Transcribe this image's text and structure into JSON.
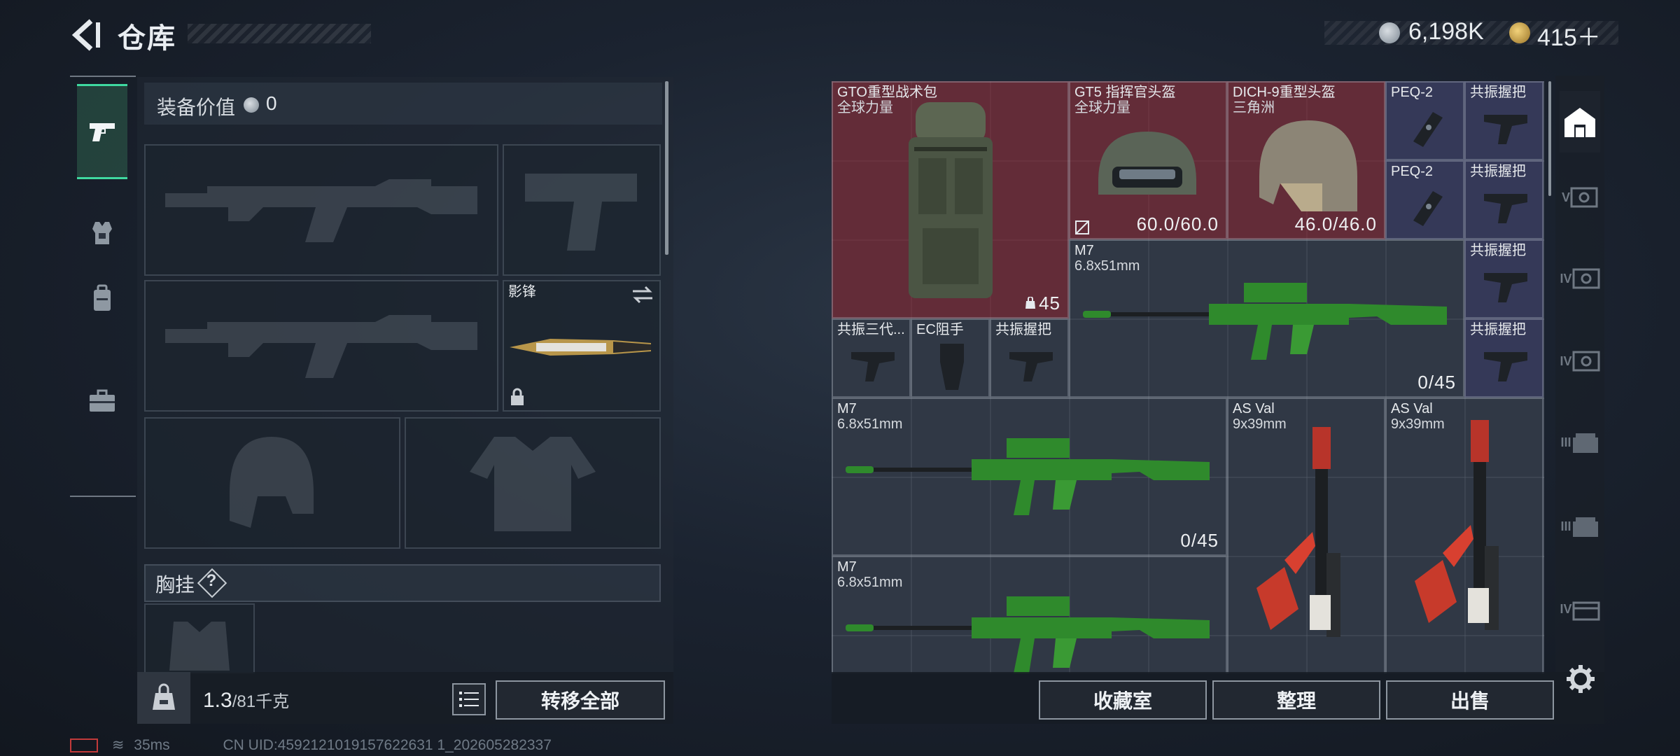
{
  "header": {
    "title": "仓库",
    "money": "6,198K",
    "coupons": "415＋",
    "version_text": "…"
  },
  "equipment": {
    "value_label": "装备价值",
    "value": "0",
    "melee_name": "影锋",
    "chest_rig_label": "胸挂",
    "help_glyph": "?",
    "weight_current": "1.3",
    "weight_max": "/81千克",
    "transfer_all": "转移全部"
  },
  "storage_items": [
    {
      "name": "GTO重型战术包",
      "sub": "全球力量",
      "value": "45"
    },
    {
      "name": "GT5 指挥官头盔",
      "sub": "全球力量",
      "value": "60.0/60.0"
    },
    {
      "name": "DICH-9重型头盔",
      "sub": "三角洲",
      "value": "46.0/46.0"
    },
    {
      "name": "PEQ-2"
    },
    {
      "name": "共振握把"
    },
    {
      "name": "PEQ-2"
    },
    {
      "name": "共振握把"
    },
    {
      "name": "M7",
      "sub": "6.8x51mm",
      "value": "0/45"
    },
    {
      "name": "共振握把"
    },
    {
      "name": "共振三代..."
    },
    {
      "name": "EC阻手"
    },
    {
      "name": "共振握把"
    },
    {
      "name": "共振握把"
    },
    {
      "name": "M7",
      "sub": "6.8x51mm",
      "value": "0/45"
    },
    {
      "name": "AS Val",
      "sub": "9x39mm"
    },
    {
      "name": "AS Val",
      "sub": "9x39mm"
    },
    {
      "name": "M7",
      "sub": "6.8x51mm"
    }
  ],
  "right_filter_tabs": [
    "V",
    "IV",
    "IV",
    "III",
    "III",
    "IV"
  ],
  "footer_buttons": {
    "collection": "收藏室",
    "organize": "整理",
    "sell": "出售"
  },
  "status": {
    "ping": "35ms",
    "uid": "CN UID:4592121019157622631 1_202605282337"
  },
  "colors": {
    "accent_green": "#3fd9a0",
    "item_red": "#782a34",
    "item_blue": "#3a3c60",
    "rifle_green": "#2f8a2c"
  }
}
